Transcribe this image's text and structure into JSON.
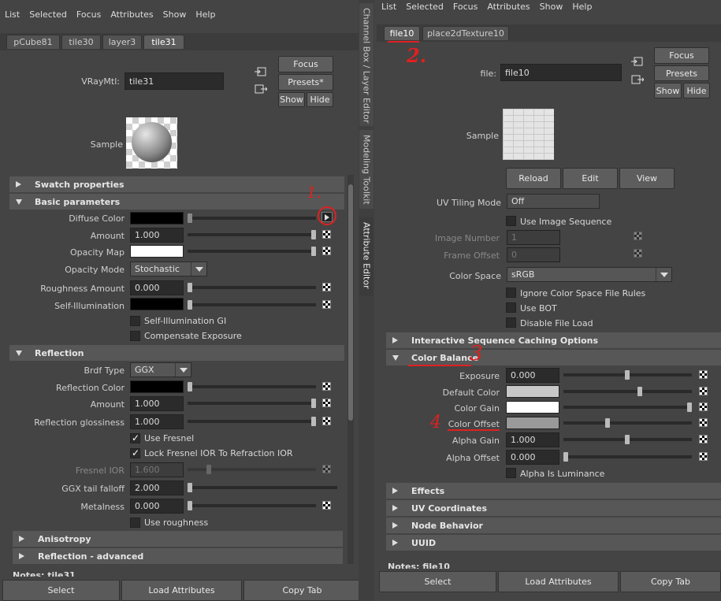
{
  "left": {
    "menu": [
      "List",
      "Selected",
      "Focus",
      "Attributes",
      "Show",
      "Help"
    ],
    "tabs": [
      "pCube81",
      "tile30",
      "layer3",
      "tile31"
    ],
    "node_label": "VRayMtl:",
    "node_name": "tile31",
    "buttons": {
      "focus": "Focus",
      "presets": "Presets*",
      "show": "Show",
      "hide": "Hide"
    },
    "sample_label": "Sample",
    "sections": {
      "swatch": "Swatch properties",
      "basic": "Basic parameters",
      "reflection": "Reflection",
      "anisotropy": "Anisotropy",
      "refl_adv": "Reflection - advanced"
    },
    "attrs": {
      "diffuse_color": "Diffuse Color",
      "amount": "Amount",
      "amount_val": "1.000",
      "opacity_map": "Opacity Map",
      "opacity_mode": "Opacity Mode",
      "opacity_mode_val": "Stochastic",
      "roughness": "Roughness Amount",
      "roughness_val": "0.000",
      "self_illum": "Self-Illumination",
      "self_illum_gi": "Self-Illumination GI",
      "comp_exposure": "Compensate Exposure",
      "brdf": "Brdf Type",
      "brdf_val": "GGX",
      "refl_color": "Reflection Color",
      "refl_amount": "Amount",
      "refl_amount_val": "1.000",
      "refl_gloss": "Reflection glossiness",
      "refl_gloss_val": "1.000",
      "use_fresnel": "Use Fresnel",
      "lock_fresnel": "Lock Fresnel IOR To Refraction IOR",
      "fresnel_ior": "Fresnel IOR",
      "fresnel_ior_val": "1.600",
      "ggx_tail": "GGX tail falloff",
      "ggx_tail_val": "2.000",
      "metalness": "Metalness",
      "metalness_val": "0.000",
      "use_roughness": "Use roughness"
    },
    "notes": "Notes:  tile31",
    "bottom": [
      "Select",
      "Load Attributes",
      "Copy Tab"
    ]
  },
  "vtabs": [
    "Channel Box / Layer Editor",
    "Modeling Toolkit",
    "Attribute Editor"
  ],
  "right": {
    "menu": [
      "List",
      "Selected",
      "Focus",
      "Attributes",
      "Show",
      "Help"
    ],
    "tabs": [
      "file10",
      "place2dTexture10"
    ],
    "node_label": "file:",
    "node_name": "file10",
    "buttons": {
      "focus": "Focus",
      "presets": "Presets",
      "show": "Show",
      "hide": "Hide"
    },
    "sample_label": "Sample",
    "actions": [
      "Reload",
      "Edit",
      "View"
    ],
    "uv_tiling": "UV Tiling Mode",
    "uv_tiling_val": "Off",
    "use_image_seq": "Use Image Sequence",
    "image_number": "Image Number",
    "image_number_val": "1",
    "frame_offset": "Frame Offset",
    "frame_offset_val": "0",
    "color_space": "Color Space",
    "color_space_val": "sRGB",
    "ignore_cs": "Ignore Color Space File Rules",
    "use_bot": "Use BOT",
    "disable_load": "Disable File Load",
    "sections": {
      "interactive": "Interactive Sequence Caching Options",
      "color_balance": "Color Balance",
      "effects": "Effects",
      "uv_coords": "UV Coordinates",
      "node_behavior": "Node Behavior",
      "uuid": "UUID"
    },
    "cb": {
      "exposure": "Exposure",
      "exposure_val": "0.000",
      "default_color": "Default Color",
      "color_gain": "Color Gain",
      "color_offset": "Color Offset",
      "alpha_gain": "Alpha Gain",
      "alpha_gain_val": "1.000",
      "alpha_offset": "Alpha Offset",
      "alpha_offset_val": "0.000",
      "alpha_lum": "Alpha Is Luminance"
    },
    "notes": "Notes:  file10",
    "bottom": [
      "Select",
      "Load Attributes",
      "Copy Tab"
    ]
  },
  "annotations": [
    "1.",
    "2.",
    "3",
    "4"
  ],
  "colors": {
    "annotation": "#e02020",
    "panel_bg": "#444444",
    "section_bg": "#575757"
  }
}
